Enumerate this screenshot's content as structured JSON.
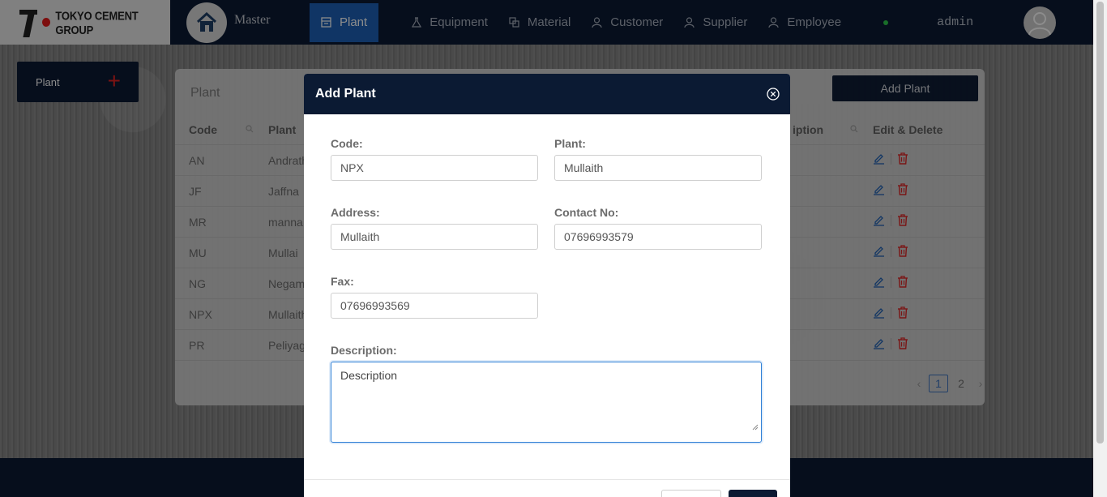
{
  "brand": {
    "company": "TOKYO CEMENT GROUP",
    "master_label": "Master"
  },
  "nav": {
    "items": [
      {
        "label": "Plant",
        "icon": "building-icon",
        "active": true
      },
      {
        "label": "Equipment",
        "icon": "flask-icon",
        "active": false
      },
      {
        "label": "Material",
        "icon": "blocks-icon",
        "active": false
      },
      {
        "label": "Customer",
        "icon": "user-icon",
        "active": false
      },
      {
        "label": "Supplier",
        "icon": "user-icon",
        "active": false
      },
      {
        "label": "Employee",
        "icon": "user-icon",
        "active": false
      }
    ],
    "user": "admin",
    "status_color": "#2ec94b"
  },
  "sidebar": {
    "plant_label": "Plant",
    "plus_symbol": "+"
  },
  "list": {
    "title": "Plant",
    "add_button": "Add Plant",
    "columns": {
      "code": "Code",
      "plant": "Plant",
      "description": "iption",
      "actions": "Edit & Delete"
    },
    "rows": [
      {
        "code": "AN",
        "plant": "Andrath"
      },
      {
        "code": "JF",
        "plant": "Jaffna"
      },
      {
        "code": "MR",
        "plant": "manna"
      },
      {
        "code": "MU",
        "plant": "Mullai"
      },
      {
        "code": "NG",
        "plant": "Negam"
      },
      {
        "code": "NPX",
        "plant": "Mullaith"
      },
      {
        "code": "PR",
        "plant": "Peliyag"
      }
    ],
    "pagination": {
      "pages": [
        "1",
        "2"
      ],
      "current": "1"
    }
  },
  "modal": {
    "title": "Add Plant",
    "fields": {
      "code": {
        "label": "Code:",
        "value": "NPX"
      },
      "plant": {
        "label": "Plant:",
        "value": "Mullaith"
      },
      "address": {
        "label": "Address:",
        "value": "Mullaith"
      },
      "contact": {
        "label": "Contact No:",
        "value": "07696993579"
      },
      "fax": {
        "label": "Fax:",
        "value": "07696993569"
      },
      "description": {
        "label": "Description:",
        "value": "Description"
      }
    }
  },
  "colors": {
    "navy": "#0b1a33",
    "accent": "#1e62b8",
    "danger": "#e42424"
  }
}
